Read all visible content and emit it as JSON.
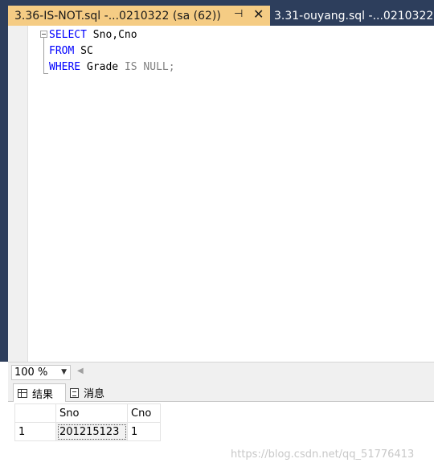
{
  "tabs": [
    {
      "title": "3.36-IS-NOT.sql -...0210322 (sa (62))",
      "pin_glyph": "⊣",
      "close_glyph": "✕",
      "active": true
    },
    {
      "title": "3.31-ouyang.sql -...0210322",
      "active": false
    }
  ],
  "editor": {
    "lines": [
      {
        "kw": "SELECT",
        "rest": " Sno,Cno"
      },
      {
        "kw": "FROM",
        "rest": " SC"
      },
      {
        "kw": "WHERE",
        "rest_ident": " Grade ",
        "op1": "IS",
        "sp": " ",
        "op2": "NULL",
        "end": ";"
      }
    ]
  },
  "zoom": {
    "value": "100 %"
  },
  "results_tabs": [
    {
      "label": "结果",
      "icon": "grid-icon"
    },
    {
      "label": "消息",
      "icon": "message-icon"
    }
  ],
  "grid": {
    "columns": [
      "",
      "Sno",
      "Cno"
    ],
    "rows": [
      [
        "1",
        "201215123",
        "1"
      ]
    ]
  },
  "watermark": "https://blog.csdn.net/qq_51776413",
  "colors": {
    "tab_active": "#f5cc84",
    "tabstrip": "#2d3e5c",
    "keyword": "#0000ff"
  }
}
